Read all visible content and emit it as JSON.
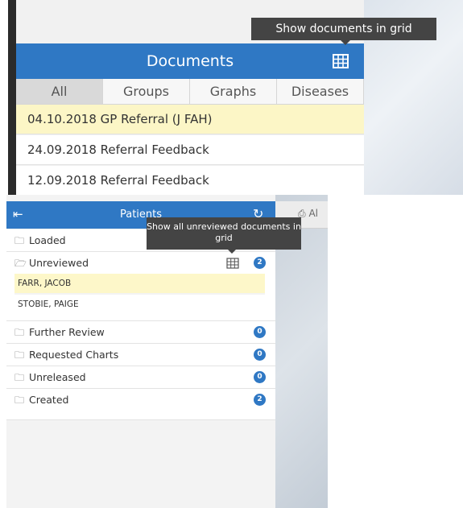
{
  "top": {
    "tooltip": "Show documents in grid",
    "header": {
      "title": "Documents",
      "grid_icon": "grid-icon"
    },
    "tabs": [
      {
        "label": "All",
        "active": true
      },
      {
        "label": "Groups",
        "active": false
      },
      {
        "label": "Graphs",
        "active": false
      },
      {
        "label": "Diseases",
        "active": false
      }
    ],
    "documents": [
      {
        "text": "04.10.2018 GP Referral (J FAH)",
        "selected": true
      },
      {
        "text": "24.09.2018 Referral Feedback",
        "selected": false
      },
      {
        "text": "12.09.2018 Referral Feedback",
        "selected": false
      }
    ]
  },
  "bottom": {
    "header": {
      "title": "Patients",
      "collapse_icon": "collapse-left-icon",
      "refresh_icon": "refresh-icon"
    },
    "tab_stub_label": "Al",
    "tooltip": "Show all unreviewed documents in grid",
    "folders": [
      {
        "label": "Loaded"
      },
      {
        "label": "Unreviewed",
        "count": "2",
        "patients": [
          "FARR, JACOB",
          "STOBIE, PAIGE"
        ]
      },
      {
        "label": "Further Review",
        "count": "0"
      },
      {
        "label": "Requested Charts",
        "count": "0"
      },
      {
        "label": "Unreleased",
        "count": "0"
      },
      {
        "label": "Created",
        "count": "2"
      }
    ]
  },
  "colors": {
    "accent": "#2f78c4",
    "selected_row": "#fcf6c6",
    "tooltip_bg": "#444444"
  }
}
